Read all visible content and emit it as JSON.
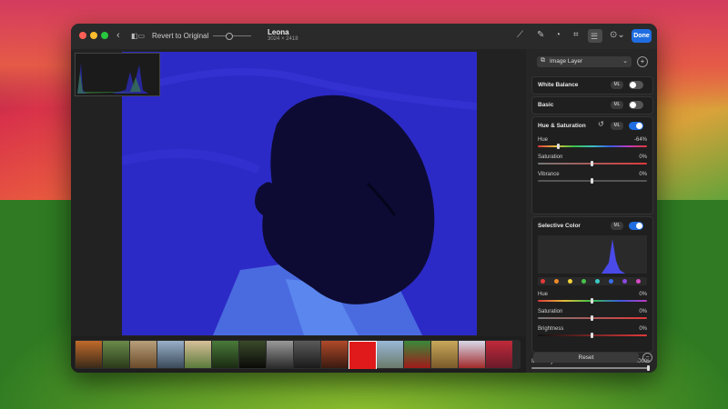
{
  "toolbar": {
    "revert_label": "Revert to Original",
    "photo_title": "Leona",
    "photo_dimensions": "3024 × 2418",
    "done_label": "Done",
    "icons": [
      "back-chevron",
      "compare",
      "zoom-slider",
      "wand",
      "retouch",
      "filters",
      "crop",
      "adjust",
      "more"
    ]
  },
  "sidebar": {
    "layer_select": "Image Layer",
    "white_balance": {
      "title": "White Balance",
      "ml": "ML",
      "enabled": false
    },
    "basic": {
      "title": "Basic",
      "ml": "ML",
      "enabled": false
    },
    "hue_saturation": {
      "title": "Hue & Saturation",
      "ml": "ML",
      "enabled": true,
      "sliders": [
        {
          "label": "Hue",
          "value": "-64%",
          "pos": 0.18
        },
        {
          "label": "Saturation",
          "value": "0%",
          "pos": 0.5
        },
        {
          "label": "Vibrance",
          "value": "0%",
          "pos": 0.5
        }
      ]
    },
    "selective_color": {
      "title": "Selective Color",
      "ml": "ML",
      "enabled": true,
      "swatches": [
        "#e23a3a",
        "#f08a2a",
        "#f2d23a",
        "#47c44a",
        "#39c9c2",
        "#3a6ee8",
        "#8a4ae0",
        "#d84ac8"
      ],
      "sliders": [
        {
          "label": "Hue",
          "value": "0%",
          "pos": 0.5
        },
        {
          "label": "Saturation",
          "value": "0%",
          "pos": 0.5
        },
        {
          "label": "Brightness",
          "value": "0%",
          "pos": 0.5
        }
      ]
    },
    "intensity": {
      "label": "Intensity",
      "value": "100%",
      "pos": 1.0
    },
    "reset_label": "Reset"
  },
  "colors": {
    "accent": "#1f6de0",
    "photo_bg": "#2a28c8"
  }
}
